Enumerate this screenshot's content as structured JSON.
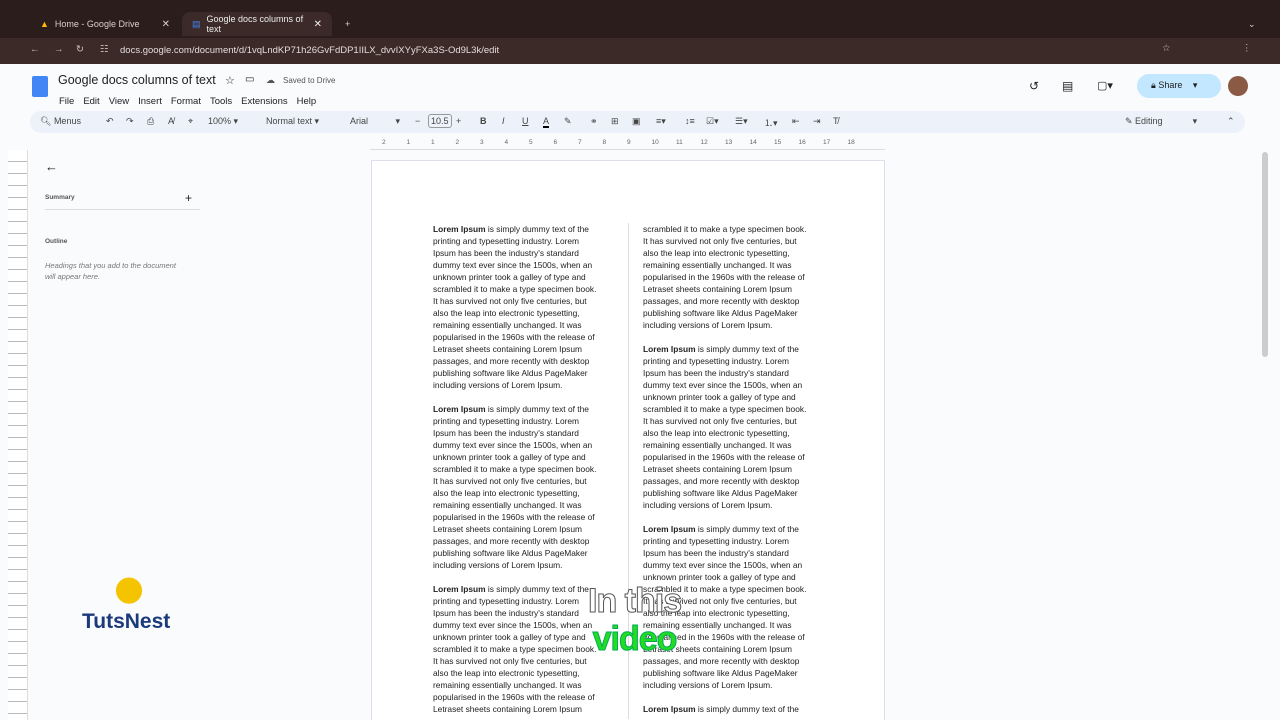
{
  "browser": {
    "tabs": [
      {
        "label": "Home - Google Drive",
        "active": false
      },
      {
        "label": "Google docs columns of text",
        "active": true
      }
    ],
    "url": "docs.google.com/document/d/1vqLndKP71h26GvFdDP1IILX_dvvIXYyFXa3S-Od9L3k/edit"
  },
  "doc": {
    "title": "Google docs columns of text",
    "save_status": "Saved to Drive",
    "menus": [
      "File",
      "Edit",
      "View",
      "Insert",
      "Format",
      "Tools",
      "Extensions",
      "Help"
    ],
    "share_label": "Share"
  },
  "toolbar": {
    "menus_label": "Menus",
    "zoom": "100%",
    "style": "Normal text",
    "font": "Arial",
    "font_size": "10.5",
    "mode": "Editing"
  },
  "ruler": [
    "2",
    "1",
    "1",
    "2",
    "3",
    "4",
    "5",
    "6",
    "7",
    "8",
    "9",
    "10",
    "11",
    "12",
    "13",
    "14",
    "15",
    "16",
    "17",
    "18"
  ],
  "sidebar": {
    "summary": "Summary",
    "outline": "Outline",
    "hint": [
      "Headings that you add to the document",
      "will appear here."
    ]
  },
  "body": {
    "bold_prefix": "Lorem Ipsum",
    "lines": [
      " is simply dummy text of the",
      "printing and typesetting industry. Lorem",
      "Ipsum has been the industry's standard",
      "dummy text ever since the 1500s, when an",
      "unknown printer took a galley of type and",
      "scrambled it to make a type specimen book.",
      "It has survived not only five centuries, but",
      "also the leap into electronic typesetting,",
      "remaining essentially unchanged. It was",
      "popularised in the 1960s with the release of",
      "Letraset sheets containing Lorem Ipsum",
      "passages, and more recently with desktop",
      "publishing software like Aldus PageMaker",
      "including versions of Lorem Ipsum."
    ]
  },
  "logo": "TutsNest",
  "caption": {
    "line1": "In this",
    "line2": "video"
  },
  "colors": {
    "share_bg": "#c2e7ff",
    "doc_blue": "#4285f4",
    "caption_green": "#22dd22"
  }
}
